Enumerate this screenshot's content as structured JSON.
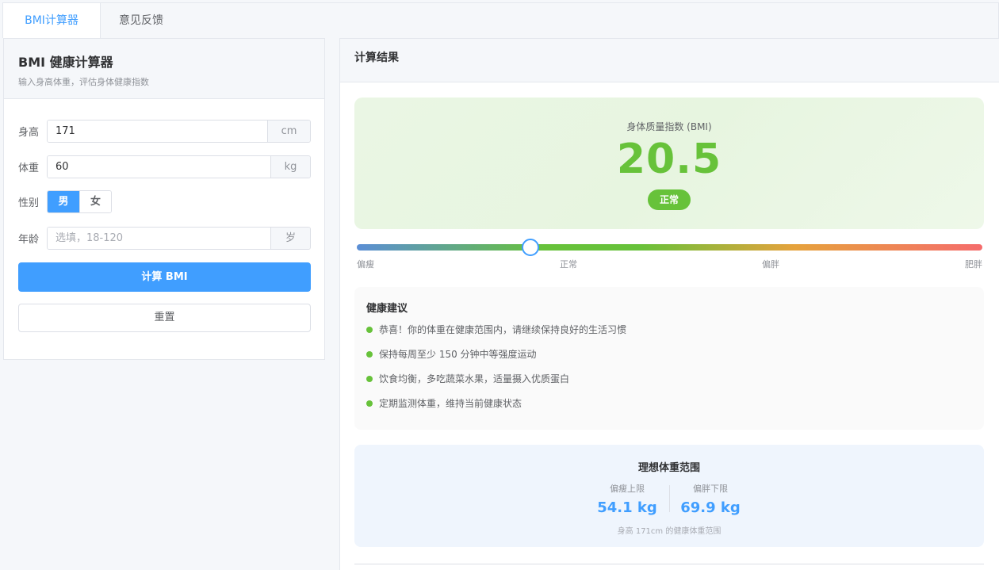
{
  "tabs": [
    {
      "label": "BMI计算器",
      "active": true
    },
    {
      "label": "意见反馈",
      "active": false
    }
  ],
  "form": {
    "title": "BMI 健康计算器",
    "subtitle": "输入身高体重，评估身体健康指数",
    "height": {
      "label": "身高",
      "value": "171",
      "unit": "cm"
    },
    "weight": {
      "label": "体重",
      "value": "60",
      "unit": "kg"
    },
    "gender": {
      "label": "性别",
      "male": "男",
      "female": "女",
      "selected": "男"
    },
    "age": {
      "label": "年龄",
      "placeholder": "选填，18-120",
      "unit": "岁"
    },
    "calc_button": "计算 BMI",
    "reset_button": "重置"
  },
  "result": {
    "header": "计算结果",
    "bmi_label": "身体质量指数 (BMI)",
    "bmi_value": "20.5",
    "status": "正常",
    "scale_labels": [
      "偏瘦",
      "正常",
      "偏胖",
      "肥胖"
    ],
    "scale_position": 0.277,
    "advice_title": "健康建议",
    "advice": [
      "恭喜！你的体重在健康范围内，请继续保持良好的生活习惯",
      "保持每周至少 150 分钟中等强度运动",
      "饮食均衡，多吃蔬菜水果，适量摄入优质蛋白",
      "定期监测体重，维持当前健康状态"
    ],
    "ideal": {
      "title": "理想体重范围",
      "lower_label": "偏瘦上限",
      "lower_value": "54.1 kg",
      "upper_label": "偏胖下限",
      "upper_value": "69.9 kg",
      "note": "身高 171cm 的健康体重范围"
    }
  },
  "colors": {
    "primary": "#409eff",
    "success": "#67c23a"
  }
}
